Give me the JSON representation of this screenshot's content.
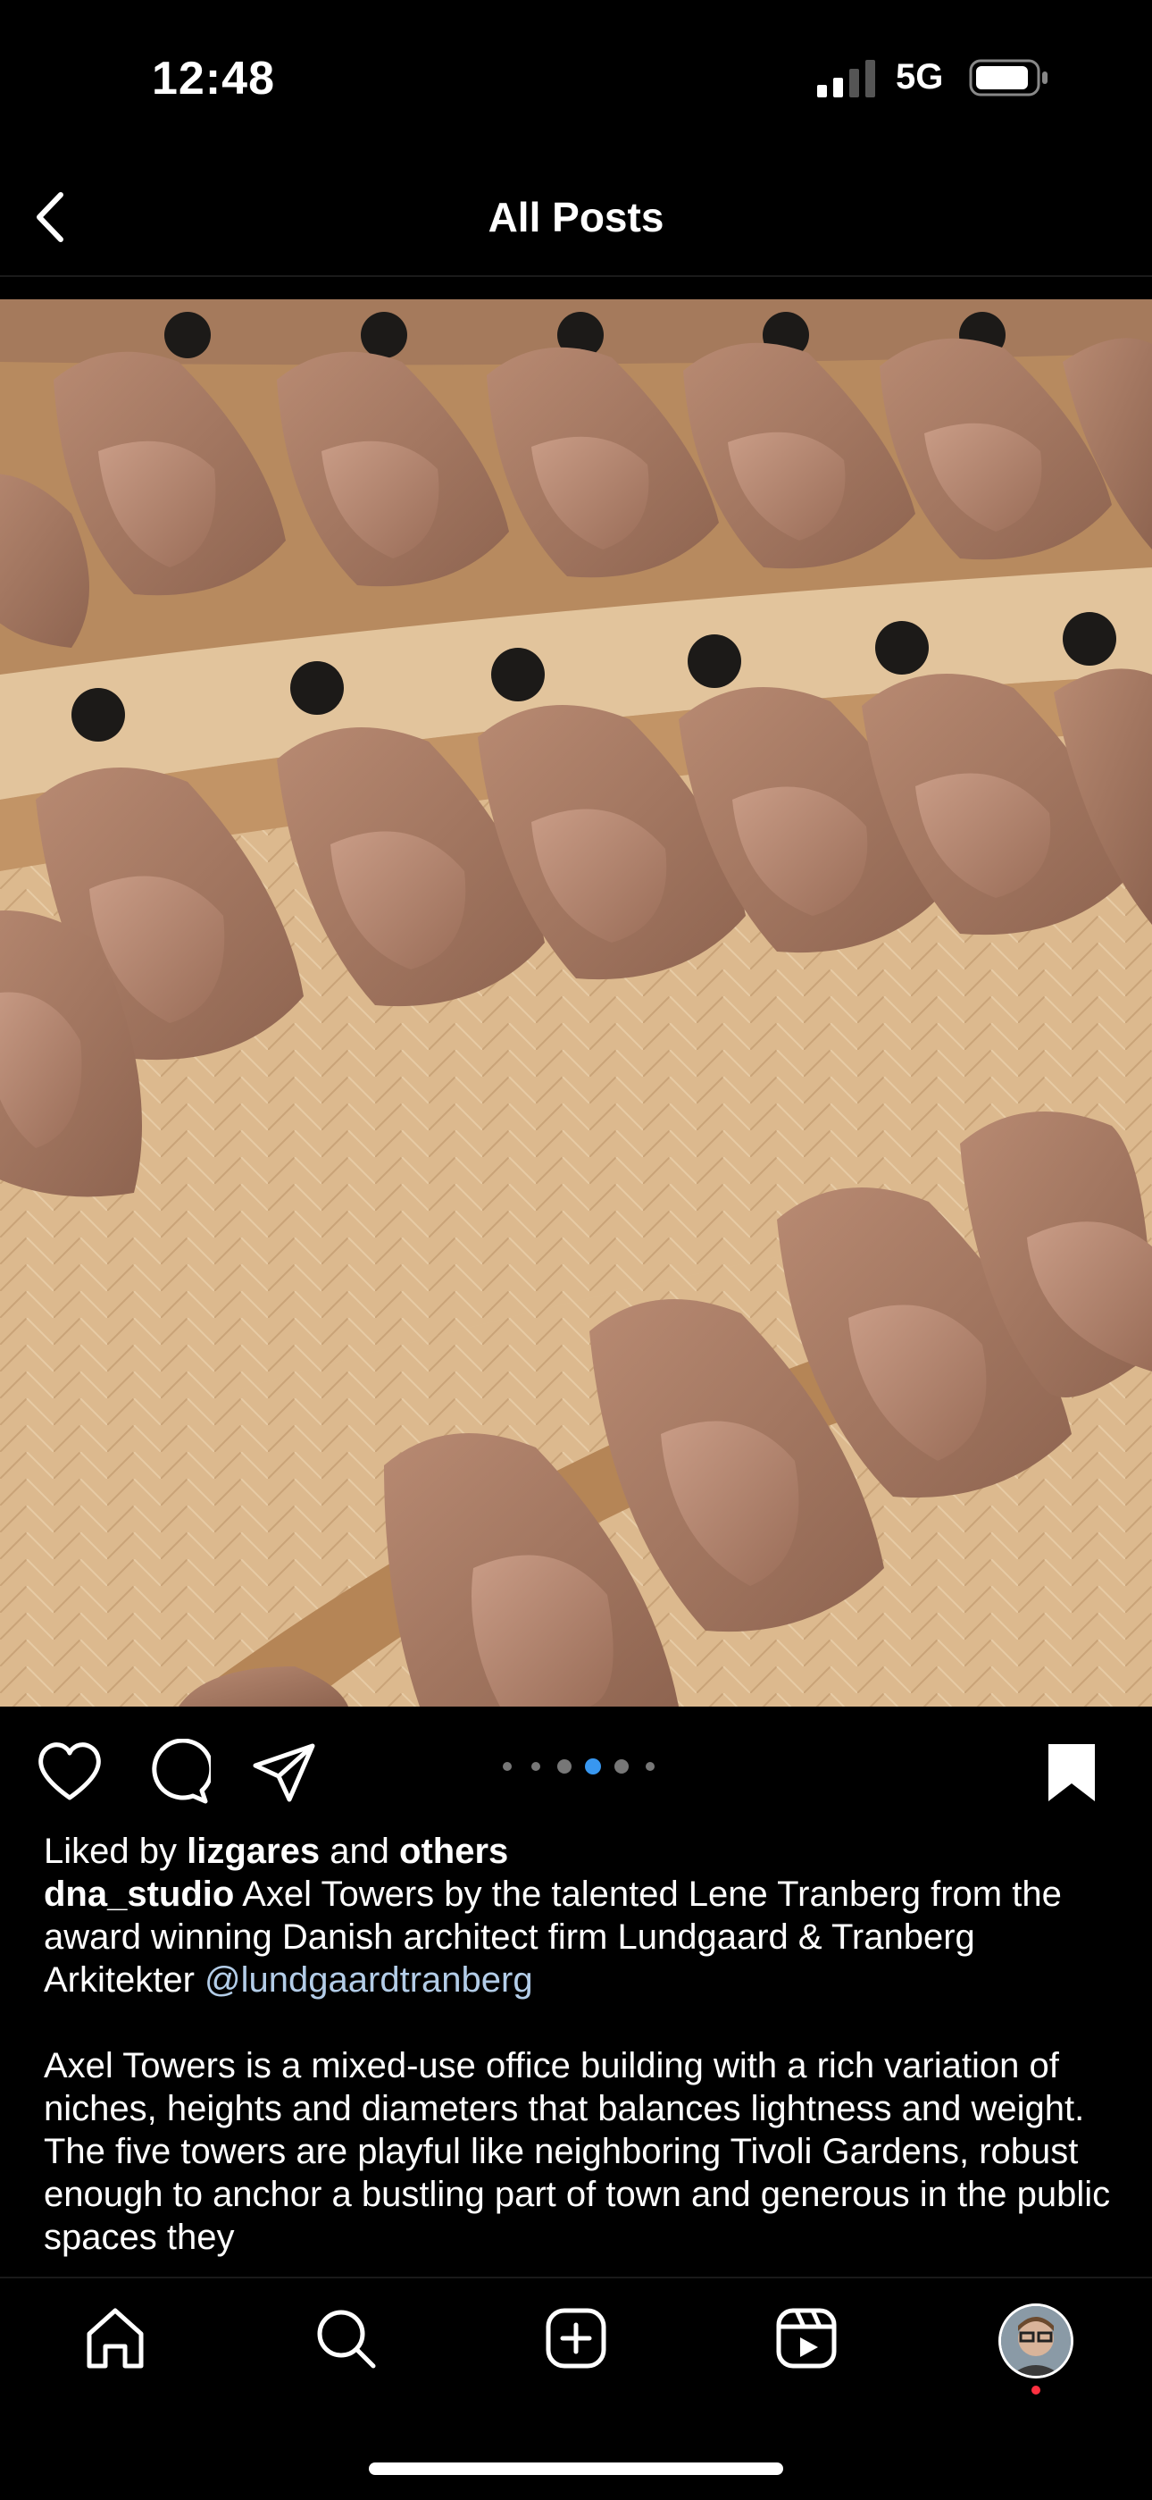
{
  "status_bar": {
    "time": "12:48",
    "network": "5G"
  },
  "nav": {
    "title": "All Posts"
  },
  "post": {
    "carousel": {
      "count": 6,
      "active_index": 3
    },
    "liked_by_prefix": "Liked by ",
    "liked_by_user": "lizgares",
    "liked_by_middle": " and ",
    "liked_by_others": "others",
    "username": "dna_studio",
    "caption_text": " Axel Towers by the talented Lene Tranberg from the award winning Danish architect firm Lundgaard & Tranberg Arkitekter ",
    "caption_mention": "@lundgaardtranberg",
    "caption_paragraph": "Axel Towers is a mixed-use office building with a rich variation of niches, heights and diameters that balances lightness and weight. The five towers are playful like neighboring Tivoli Gardens, robust enough to anchor a bustling part of town and generous in the public spaces they"
  },
  "colors": {
    "accent_blue": "#3897f0",
    "notification": "#ff3040"
  },
  "icons": [
    "signal-icon",
    "battery-icon",
    "back-chevron-icon",
    "heart-icon",
    "comment-icon",
    "share-icon",
    "bookmark-icon",
    "home-icon",
    "search-icon",
    "create-icon",
    "reels-icon"
  ]
}
